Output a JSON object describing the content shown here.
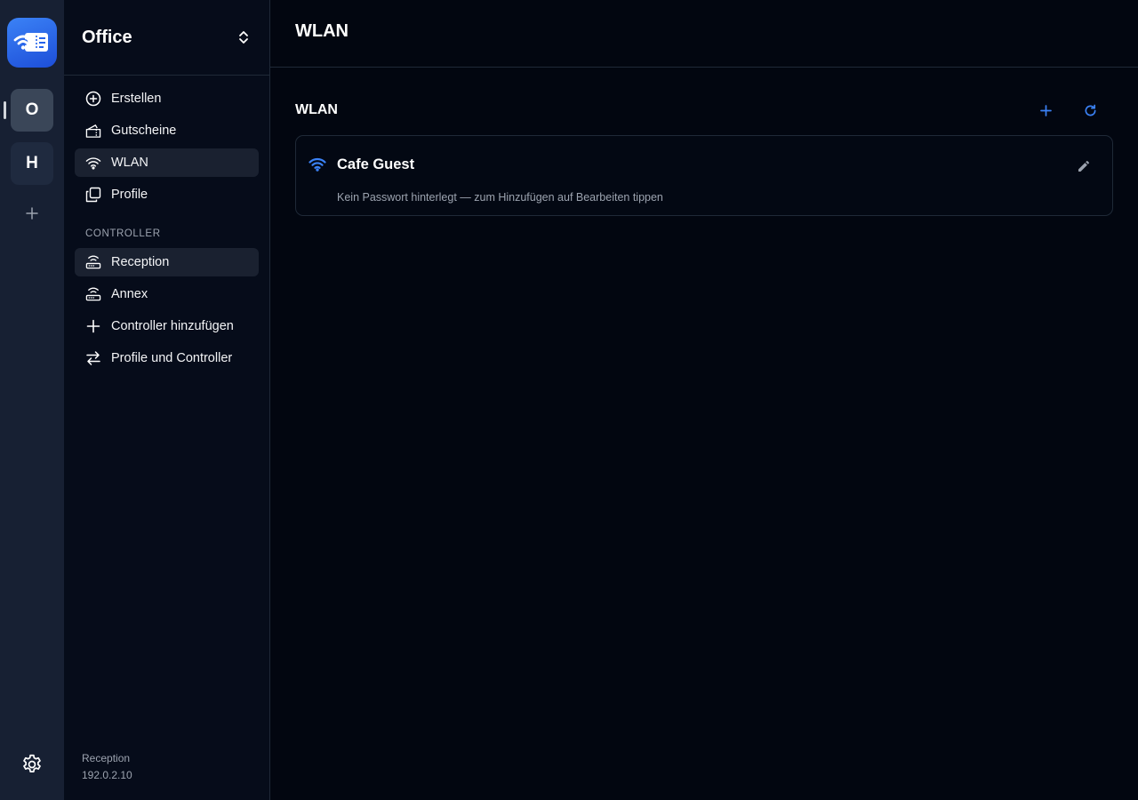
{
  "rail": {
    "workspaces": [
      {
        "initial": "O",
        "active": true
      },
      {
        "initial": "H",
        "active": false
      }
    ],
    "icons": {
      "logo": "wifi-ticket-icon",
      "add": "plus-icon",
      "settings": "gear-icon"
    }
  },
  "sidebar": {
    "workspace_name": "Office",
    "nav_items": [
      {
        "label": "Erstellen",
        "icon": "plus-circle-icon",
        "active": false
      },
      {
        "label": "Gutscheine",
        "icon": "ticket-icon",
        "active": false
      },
      {
        "label": "WLAN",
        "icon": "wifi-icon",
        "active": true
      },
      {
        "label": "Profile",
        "icon": "copy-icon",
        "active": false
      }
    ],
    "controller_section_label": "CONTROLLER",
    "controller_items": [
      {
        "label": "Reception",
        "icon": "router-icon",
        "active": true
      },
      {
        "label": "Annex",
        "icon": "router-icon",
        "active": false
      },
      {
        "label": "Controller hinzufügen",
        "icon": "plus-icon",
        "active": false
      },
      {
        "label": "Profile und Controller",
        "icon": "arrows-swap-icon",
        "active": false
      }
    ],
    "footer": {
      "controller_name": "Reception",
      "controller_ip": "192.0.2.10"
    }
  },
  "main": {
    "title": "WLAN",
    "section_title": "WLAN",
    "networks": [
      {
        "name": "Cafe Guest",
        "subtitle": "Kein Passwort hinterlegt — zum Hinzufügen auf Bearbeiten tippen"
      }
    ]
  },
  "colors": {
    "accent": "#3b82f6",
    "rail_bg": "#172033",
    "sidebar_bg": "#060c1a",
    "main_bg": "#020610"
  }
}
